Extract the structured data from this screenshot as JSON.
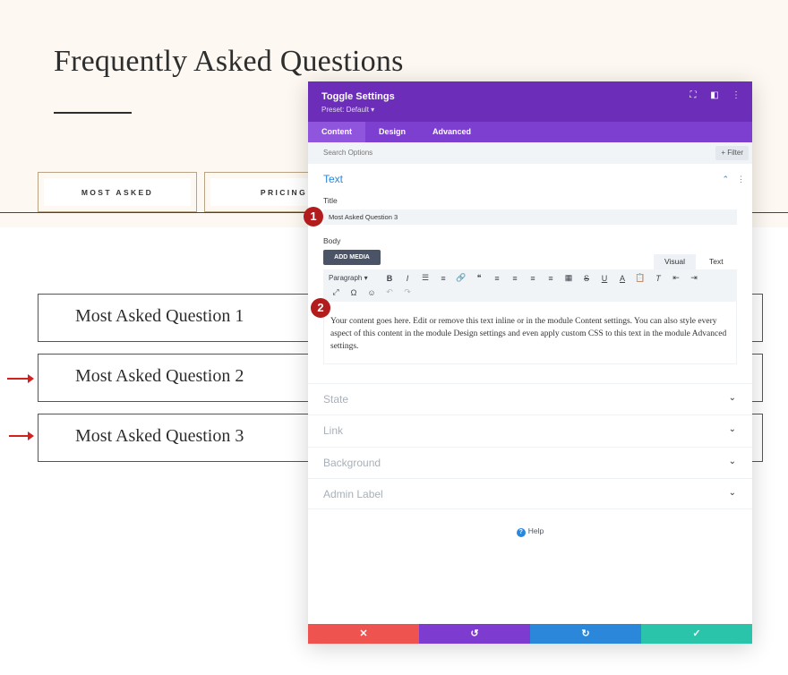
{
  "page": {
    "title": "Frequently Asked Questions",
    "tabs": [
      "MOST ASKED",
      "PRICING"
    ],
    "questions": [
      "Most Asked Question 1",
      "Most Asked Question 2",
      "Most Asked Question 3"
    ]
  },
  "modal": {
    "title": "Toggle Settings",
    "preset": "Preset: Default ▾",
    "header_icons": [
      "fullscreen-icon",
      "split-view-icon",
      "more-options-icon"
    ],
    "tabs": [
      "Content",
      "Design",
      "Advanced"
    ],
    "active_tab": "Content",
    "search_placeholder": "Search Options",
    "filter_label": "+ Filter",
    "section_title": "Text",
    "title_label": "Title",
    "title_value": "Most Asked Question 3",
    "body_label": "Body",
    "add_media_label": "ADD MEDIA",
    "editor_tab_visual": "Visual",
    "editor_tab_text": "Text",
    "paragraph_select": "Paragraph",
    "body_content": "Your content goes here. Edit or remove this text inline or in the module Content settings. You can also style every aspect of this content in the module Design settings and even apply custom CSS to this text in the module Advanced settings.",
    "collapsed_sections": [
      "State",
      "Link",
      "Background",
      "Admin Label"
    ],
    "help_label": "Help",
    "footer_colors": {
      "cancel": "#ef5350",
      "undo": "#7e3bd0",
      "redo": "#2b87da",
      "save": "#29c4a9"
    }
  },
  "annotations": [
    "1",
    "2"
  ],
  "colors": {
    "accent_purple": "#6c2eb9",
    "link_blue": "#2b87da",
    "arrow_red": "#d32020",
    "badge_red": "#b31c1c"
  }
}
